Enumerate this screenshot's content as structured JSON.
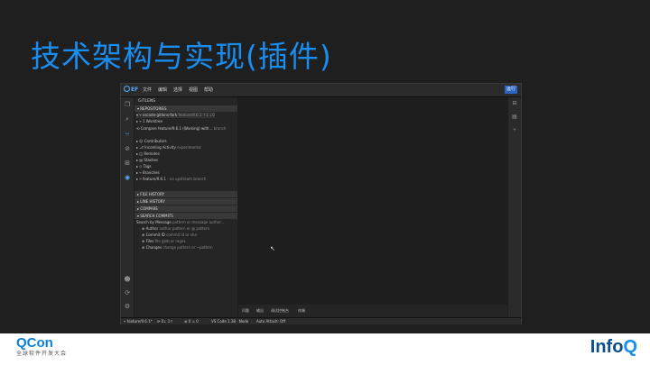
{
  "slide_title": "技术架构与实现(插件)",
  "footer": {
    "left_brand": "QCon",
    "left_sub": "全球软件开发大会",
    "right_brand_info": "Info",
    "right_brand_q": "Q"
  },
  "app": {
    "logo": "EF",
    "menu": [
      "文件",
      "编辑",
      "选择",
      "视图",
      "帮助"
    ],
    "menu_button": "运行",
    "activity_icons": [
      "explorer-icon",
      "search-icon",
      "git-icon",
      "debug-icon",
      "extensions-icon",
      "github-icon"
    ],
    "activity_bottom_icons": [
      "account-icon",
      "sync-icon",
      "settings-icon"
    ],
    "sidebar_title": "GITLENS",
    "sections": {
      "repositories": "▾ REPOSITORIES",
      "file_history": "▸ FILE HISTORY",
      "line_history": "▸ LINE HISTORY",
      "compare": "▸ COMPARE",
      "search_commits": "▾ SEARCH COMMITS"
    },
    "repo_rows": [
      {
        "text": "▾ ⑂ vscode-gitlens-fork",
        "dim": " feature/9.6.1  ↑1  ↓0"
      },
      {
        "text": "  ▸ ⑂ 1 Worktree",
        "dim": ""
      },
      {
        "text": "  ⟲ Compare feature/9.6.1 (Working) with... ",
        "dim": "branch"
      },
      {
        "text": "  ▸ ☺ Contributors",
        "dim": ""
      },
      {
        "text": "  ▸ ⎇ Incoming Activity",
        "dim": " experimental"
      },
      {
        "text": "  ▸ ◫ Remotes",
        "dim": ""
      },
      {
        "text": "  ▸ ▤ Stashes",
        "dim": ""
      },
      {
        "text": "  ▸ ◇ Tags",
        "dim": ""
      },
      {
        "text": "  ▸ ⑂ Branches",
        "dim": ""
      },
      {
        "text": "  ▸ ⑂ feature/9.6.1",
        "dim": " · no upstream branch"
      }
    ],
    "search_rows": [
      {
        "text": "Search by Message",
        "dim": " pattern or message author..."
      },
      {
        "text": "  ⊕ Author",
        "dim": " author pattern or @ pattern"
      },
      {
        "text": "  ⊕ Commit ID",
        "dim": " commit id or sha"
      },
      {
        "text": "  ⊕ Files",
        "dim": " file glob or regex"
      },
      {
        "text": "  ⊕ Changes",
        "dim": " change pattern or ~pattern"
      }
    ],
    "panel_tabs": [
      "问题",
      "输出",
      "调试控制台",
      "终端"
    ],
    "right_icons": [
      "split-icon",
      "preview-icon",
      "branch-icon"
    ],
    "status": {
      "branch": "⑂ feature/9.6.1*",
      "sync": "⟳ 0↓ 1↑",
      "errors": "⊗ 0 ⚠ 0",
      "ide": "VS Code 1.38 · Node",
      "lang": "Auto Attach: Off"
    }
  }
}
